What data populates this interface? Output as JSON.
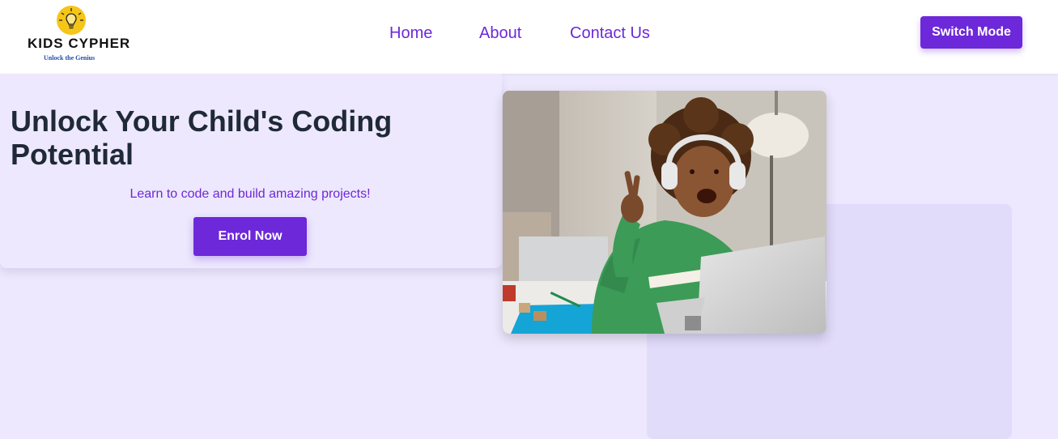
{
  "logo": {
    "title": "KIDS CYPHER",
    "tagline": "Unlock the Genius",
    "icon": "lightbulb-icon"
  },
  "nav": {
    "items": [
      {
        "label": "Home"
      },
      {
        "label": "About"
      },
      {
        "label": "Contact Us"
      }
    ],
    "switch_label": "Switch Mode"
  },
  "hero": {
    "title": "Unlock Your Child's Coding Potential",
    "subtitle": "Learn to code and build amazing projects!",
    "cta_label": "Enrol Now",
    "image": "child-with-headphones-waving-at-laptop-photo"
  },
  "colors": {
    "accent": "#6d28d9",
    "background": "#ede8fd",
    "panel": "#e2dcfb",
    "heading": "#1f2937"
  }
}
